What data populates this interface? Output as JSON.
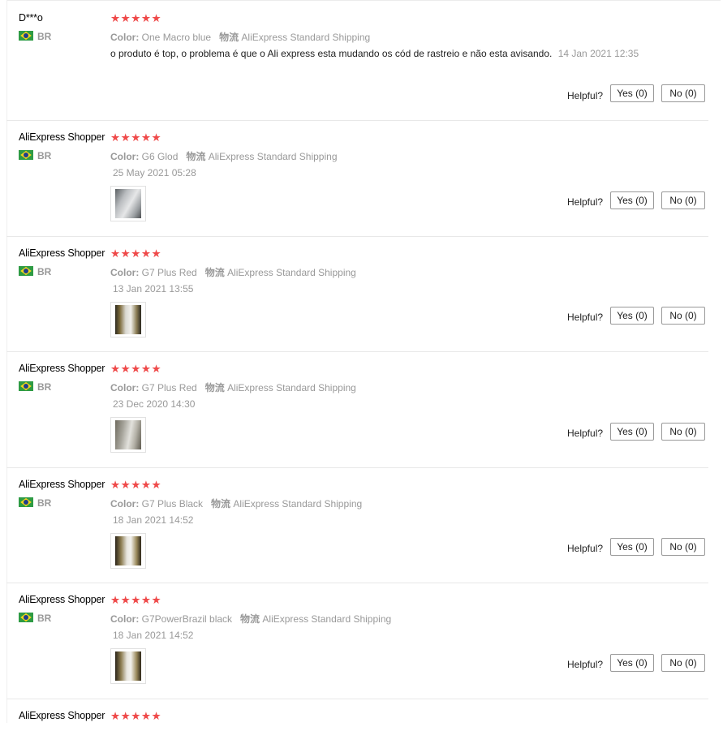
{
  "labels": {
    "color": "Color:",
    "shipping_label": "物流",
    "helpful": "Helpful?"
  },
  "star_color": "#ef4a4a",
  "reviews": [
    {
      "user": "D***o",
      "country": "BR",
      "rating": 5,
      "color": "One Macro blue",
      "shipping": "AliExpress Standard Shipping",
      "text": "o produto é top, o problema é que o Ali express esta mudando os cód de rastreio e não esta avisando.",
      "date": "14 Jan 2021 12:35",
      "yes": "Yes (0)",
      "no": "No (0)"
    },
    {
      "user": "AliExpress Shopper",
      "country": "BR",
      "rating": 5,
      "color": "G6 Glod",
      "shipping": "AliExpress Standard Shipping",
      "date": "25 May 2021 05:28",
      "yes": "Yes (0)",
      "no": "No (0)"
    },
    {
      "user": "AliExpress Shopper",
      "country": "BR",
      "rating": 5,
      "color": "G7 Plus Red",
      "shipping": "AliExpress Standard Shipping",
      "date": "13 Jan 2021 13:55",
      "yes": "Yes (0)",
      "no": "No (0)"
    },
    {
      "user": "AliExpress Shopper",
      "country": "BR",
      "rating": 5,
      "color": "G7 Plus Red",
      "shipping": "AliExpress Standard Shipping",
      "date": "23 Dec 2020 14:30",
      "yes": "Yes (0)",
      "no": "No (0)"
    },
    {
      "user": "AliExpress Shopper",
      "country": "BR",
      "rating": 5,
      "color": "G7 Plus Black",
      "shipping": "AliExpress Standard Shipping",
      "date": "18 Jan 2021 14:52",
      "yes": "Yes (0)",
      "no": "No (0)"
    },
    {
      "user": "AliExpress Shopper",
      "country": "BR",
      "rating": 5,
      "color": "G7PowerBrazil black",
      "shipping": "AliExpress Standard Shipping",
      "date": "18 Jan 2021 14:52",
      "yes": "Yes (0)",
      "no": "No (0)"
    },
    {
      "user": "AliExpress Shopper",
      "rating": 5
    }
  ]
}
